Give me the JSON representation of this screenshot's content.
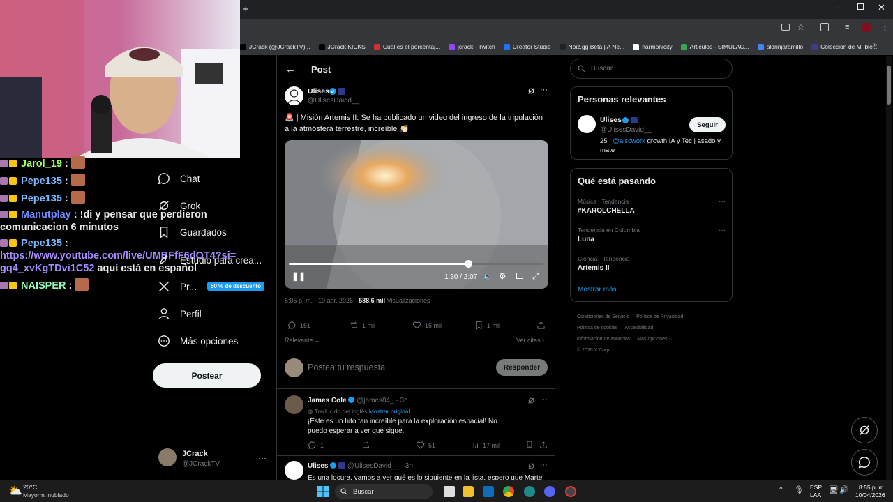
{
  "browser": {
    "new_tab": "+",
    "bookmarks": [
      {
        "label": "JCrack (@JCrackTV)...",
        "color": "#000000"
      },
      {
        "label": "JCrack KICKS",
        "color": "#000000"
      },
      {
        "label": "Cuál es el porcentaj...",
        "color": "#d32f2f"
      },
      {
        "label": "jcrack - Twitch",
        "color": "#9146ff"
      },
      {
        "label": "Creator Studio",
        "color": "#1877f2"
      },
      {
        "label": "Noiz.gg Beta | A Ne...",
        "color": "#222222"
      },
      {
        "label": "harmonicity",
        "color": "#ffffff"
      },
      {
        "label": "Articulos - SIMULAC...",
        "color": "#34a853"
      },
      {
        "label": "aldrinjaramillo",
        "color": "#4285f4"
      },
      {
        "label": "Colección de M_blei...",
        "color": "#3b3b8f"
      }
    ]
  },
  "chat": [
    {
      "user": "Jarol_19",
      "color": "#9dff5f",
      "text": ""
    },
    {
      "user": "Pepe135",
      "color": "#7ab8ff",
      "text": ""
    },
    {
      "user": "Pepe135",
      "color": "#7ab8ff",
      "text": ""
    },
    {
      "user": "Manutplay",
      "color": "#6e8cff",
      "text": "!di y pensar que perdieron comunicacion 6 minutos"
    },
    {
      "user": "Pepe135",
      "color": "#7ab8ff",
      "text": "",
      "link": "https://www.youtube.com/live/UMBFfF6dOT4?si=gq4_xvKgTDvi1C52",
      "after": "aquí está en español"
    },
    {
      "user": "NAISPER",
      "color": "#8dffb4",
      "text": ""
    }
  ],
  "nav": {
    "chat": "Chat",
    "grok": "Grok",
    "saved": "Guardados",
    "studio": "Estudio para crea...",
    "premium": "Pr...",
    "premium_badge": "50 % de descuento",
    "profile": "Perfil",
    "more": "Más opciones",
    "post_button": "Postear",
    "account_name": "JCrack",
    "account_handle": "@JCrackTV"
  },
  "post": {
    "header": "Post",
    "author": "Ulises",
    "handle": "@UlisesDavid__",
    "text": "🚨 | Misión Artemis II: Se ha publicado un video del ingreso de la tripulación a la atmósfera terrestre, increíble 👏🏻",
    "video_time": "1:30 / 2:07",
    "video_progress": 0.705,
    "timestamp": "5:05 p. m. · 10 abr. 2026 · ",
    "views_count": "588,6 mil",
    "views_label": " Visualizaciones",
    "replies": "151",
    "reposts": "1 mil",
    "likes": "15 mil",
    "bookmarks": "1 mil",
    "sort": "Relevante",
    "quotes": "Ver citas",
    "reply_placeholder": "Postea tu respuesta",
    "reply_button": "Responder"
  },
  "replies": [
    {
      "name": "James Cole",
      "handle": "@james84_",
      "time": "· 3h",
      "translated": "Traducido del inglés",
      "show_original": "Mostrar original",
      "text": "¡Este es un hito tan increíble para la exploración espacial! No puedo esperar a ver qué sigue.",
      "replies": "1",
      "reposts": "",
      "likes": "51",
      "views": "17 mil"
    },
    {
      "name": "Ulises",
      "handle": "@UlisesDavid__",
      "time": "· 3h",
      "text": "Es una locura, vamos a ver qué es lo siguiente en la lista, espero que Marte"
    }
  ],
  "sidebar": {
    "search_placeholder": "Buscar",
    "relevant_title": "Personas relevantes",
    "rel_name": "Ulises",
    "rel_handle": "@UlisesDavid__",
    "follow": "Seguir",
    "bio_pre": "25 | ",
    "bio_link": "@aiscwork",
    "bio_post": " growth IA y Tec | asado y mate",
    "happening_title": "Qué está pasando",
    "trends": [
      {
        "context": "Música · Tendencia",
        "name": "#KAROLCHELLA"
      },
      {
        "context": "Tendencia en Colombia",
        "name": "Luna"
      },
      {
        "context": "Ciencia · Tendencia",
        "name": "Artemis II"
      }
    ],
    "show_more": "Mostrar más",
    "footer": [
      "Condiciones de Servicio",
      "Política de Privacidad",
      "Política de cookies",
      "Accesibilidad",
      "Información de anuncios",
      "Más opciones ···",
      "© 2026 X Corp."
    ]
  },
  "taskbar": {
    "temp": "20°C",
    "weather": "Mayorm. nublado",
    "search": "Buscar",
    "lang1": "ESP",
    "lang2": "LAA",
    "time": "8:55 p. m.",
    "date": "10/04/2026"
  }
}
